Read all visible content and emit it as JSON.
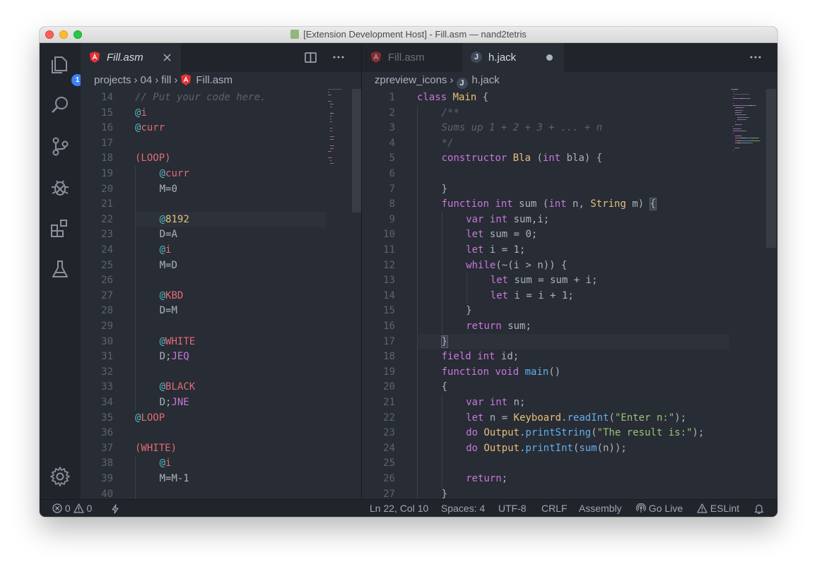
{
  "window": {
    "title": "[Extension Development Host] - Fill.asm — nand2tetris"
  },
  "activity_bar": {
    "items": [
      {
        "name": "explorer-icon",
        "badge": "1"
      },
      {
        "name": "search-icon"
      },
      {
        "name": "source-control-icon"
      },
      {
        "name": "debug-icon"
      },
      {
        "name": "extensions-icon"
      },
      {
        "name": "testing-icon"
      }
    ],
    "manage": "gear-icon"
  },
  "left_editor": {
    "tab": {
      "label": "Fill.asm"
    },
    "breadcrumb": [
      "projects",
      "04",
      "fill",
      "Fill.asm"
    ],
    "lines": [
      {
        "n": "14",
        "tokens": [
          [
            "c",
            "// Put your code here."
          ]
        ],
        "indent": 0
      },
      {
        "n": "15",
        "tokens": [
          [
            "a",
            "@"
          ],
          [
            "r",
            "i"
          ]
        ],
        "indent": 0
      },
      {
        "n": "16",
        "tokens": [
          [
            "a",
            "@"
          ],
          [
            "r",
            "curr"
          ]
        ],
        "indent": 0
      },
      {
        "n": "17",
        "tokens": [],
        "indent": 0
      },
      {
        "n": "18",
        "tokens": [
          [
            "r",
            "(LOOP)"
          ]
        ],
        "indent": 0
      },
      {
        "n": "19",
        "tokens": [
          [
            "a",
            "@"
          ],
          [
            "r",
            "curr"
          ]
        ],
        "indent": 1
      },
      {
        "n": "20",
        "tokens": [
          [
            "p",
            "M=0"
          ]
        ],
        "indent": 1
      },
      {
        "n": "21",
        "tokens": [],
        "indent": 1
      },
      {
        "n": "22",
        "tokens": [
          [
            "a",
            "@"
          ],
          [
            "y",
            "8192"
          ]
        ],
        "indent": 1
      },
      {
        "n": "23",
        "tokens": [
          [
            "p",
            "D=A"
          ]
        ],
        "indent": 1
      },
      {
        "n": "24",
        "tokens": [
          [
            "a",
            "@"
          ],
          [
            "r",
            "i"
          ]
        ],
        "indent": 1
      },
      {
        "n": "25",
        "tokens": [
          [
            "p",
            "M=D"
          ]
        ],
        "indent": 1
      },
      {
        "n": "26",
        "tokens": [],
        "indent": 1
      },
      {
        "n": "27",
        "tokens": [
          [
            "a",
            "@"
          ],
          [
            "r",
            "KBD"
          ]
        ],
        "indent": 1
      },
      {
        "n": "28",
        "tokens": [
          [
            "p",
            "D=M"
          ]
        ],
        "indent": 1
      },
      {
        "n": "29",
        "tokens": [],
        "indent": 1
      },
      {
        "n": "30",
        "tokens": [
          [
            "a",
            "@"
          ],
          [
            "r",
            "WHITE"
          ]
        ],
        "indent": 1
      },
      {
        "n": "31",
        "tokens": [
          [
            "p",
            "D;"
          ],
          [
            "k",
            "JEQ"
          ]
        ],
        "indent": 1
      },
      {
        "n": "32",
        "tokens": [],
        "indent": 1
      },
      {
        "n": "33",
        "tokens": [
          [
            "a",
            "@"
          ],
          [
            "r",
            "BLACK"
          ]
        ],
        "indent": 1
      },
      {
        "n": "34",
        "tokens": [
          [
            "p",
            "D;"
          ],
          [
            "k",
            "JNE"
          ]
        ],
        "indent": 1
      },
      {
        "n": "35",
        "tokens": [
          [
            "a",
            "@"
          ],
          [
            "r",
            "LOOP"
          ]
        ],
        "indent": 0
      },
      {
        "n": "36",
        "tokens": [],
        "indent": 0
      },
      {
        "n": "37",
        "tokens": [
          [
            "r",
            "(WHITE)"
          ]
        ],
        "indent": 0
      },
      {
        "n": "38",
        "tokens": [
          [
            "a",
            "@"
          ],
          [
            "r",
            "i"
          ]
        ],
        "indent": 1
      },
      {
        "n": "39",
        "tokens": [
          [
            "p",
            "M=M-1"
          ]
        ],
        "indent": 1
      },
      {
        "n": "40",
        "tokens": [],
        "indent": 1
      }
    ]
  },
  "right_editor": {
    "tabs": [
      {
        "label": "Fill.asm",
        "icon": "angular-icon",
        "active": false
      },
      {
        "label": "h.jack",
        "icon": "jack-icon",
        "active": true,
        "dirty": true
      }
    ],
    "breadcrumb": [
      "zpreview_icons",
      "h.jack"
    ],
    "lines": [
      {
        "n": "1",
        "indent": 0,
        "tokens": [
          [
            "k",
            "class "
          ],
          [
            "t",
            "Main"
          ],
          [
            "p",
            " {"
          ]
        ]
      },
      {
        "n": "2",
        "indent": 1,
        "tokens": [
          [
            "c",
            "/**"
          ]
        ]
      },
      {
        "n": "3",
        "indent": 1,
        "tokens": [
          [
            "c",
            "Sums up 1 + 2 + 3 + ... + n"
          ]
        ]
      },
      {
        "n": "4",
        "indent": 1,
        "tokens": [
          [
            "c",
            "*/"
          ]
        ]
      },
      {
        "n": "5",
        "indent": 1,
        "tokens": [
          [
            "k",
            "constructor "
          ],
          [
            "t",
            "Bla"
          ],
          [
            "p",
            " ("
          ],
          [
            "k",
            "int"
          ],
          [
            "p",
            " bla) {"
          ]
        ]
      },
      {
        "n": "6",
        "indent": 1,
        "tokens": []
      },
      {
        "n": "7",
        "indent": 1,
        "tokens": [
          [
            "p",
            "}"
          ]
        ]
      },
      {
        "n": "8",
        "indent": 1,
        "tokens": [
          [
            "k",
            "function "
          ],
          [
            "k",
            "int"
          ],
          [
            "p",
            " sum ("
          ],
          [
            "k",
            "int"
          ],
          [
            "p",
            " n, "
          ],
          [
            "t",
            "String"
          ],
          [
            "p",
            " m) "
          ],
          [
            "bh",
            "{"
          ]
        ]
      },
      {
        "n": "9",
        "indent": 2,
        "tokens": [
          [
            "k",
            "var "
          ],
          [
            "k",
            "int"
          ],
          [
            "p",
            " sum,i;"
          ]
        ]
      },
      {
        "n": "10",
        "indent": 2,
        "tokens": [
          [
            "k",
            "let"
          ],
          [
            "p",
            " sum = 0;"
          ]
        ]
      },
      {
        "n": "11",
        "indent": 2,
        "tokens": [
          [
            "k",
            "let"
          ],
          [
            "p",
            " i = 1;"
          ]
        ]
      },
      {
        "n": "12",
        "indent": 2,
        "tokens": [
          [
            "k",
            "while"
          ],
          [
            "p",
            "(~(i > n)) {"
          ]
        ]
      },
      {
        "n": "13",
        "indent": 3,
        "tokens": [
          [
            "k",
            "let"
          ],
          [
            "p",
            " sum = sum + i;"
          ]
        ]
      },
      {
        "n": "14",
        "indent": 3,
        "tokens": [
          [
            "k",
            "let"
          ],
          [
            "p",
            " i = i + 1;"
          ]
        ]
      },
      {
        "n": "15",
        "indent": 2,
        "tokens": [
          [
            "p",
            "}"
          ]
        ]
      },
      {
        "n": "16",
        "indent": 2,
        "tokens": [
          [
            "k",
            "return"
          ],
          [
            "p",
            " sum;"
          ]
        ]
      },
      {
        "n": "17",
        "indent": 1,
        "tokens": [
          [
            "bh",
            "}"
          ]
        ]
      },
      {
        "n": "18",
        "indent": 1,
        "tokens": [
          [
            "k",
            "field "
          ],
          [
            "k",
            "int"
          ],
          [
            "p",
            " id;"
          ]
        ]
      },
      {
        "n": "19",
        "indent": 1,
        "tokens": [
          [
            "k",
            "function "
          ],
          [
            "k",
            "void"
          ],
          [
            "p",
            " "
          ],
          [
            "f",
            "main"
          ],
          [
            "p",
            "()"
          ]
        ]
      },
      {
        "n": "20",
        "indent": 1,
        "tokens": [
          [
            "p",
            "{"
          ]
        ]
      },
      {
        "n": "21",
        "indent": 2,
        "tokens": [
          [
            "k",
            "var "
          ],
          [
            "k",
            "int"
          ],
          [
            "p",
            " n;"
          ]
        ]
      },
      {
        "n": "22",
        "indent": 2,
        "tokens": [
          [
            "k",
            "let"
          ],
          [
            "p",
            " n = "
          ],
          [
            "t",
            "Keyboard"
          ],
          [
            "p",
            "."
          ],
          [
            "f",
            "readInt"
          ],
          [
            "p",
            "("
          ],
          [
            "s",
            "\"Enter n:\""
          ],
          [
            "p",
            ");"
          ]
        ]
      },
      {
        "n": "23",
        "indent": 2,
        "tokens": [
          [
            "k",
            "do "
          ],
          [
            "t",
            "Output"
          ],
          [
            "p",
            "."
          ],
          [
            "f",
            "printString"
          ],
          [
            "p",
            "("
          ],
          [
            "s",
            "\"The result is:\""
          ],
          [
            "p",
            ");"
          ]
        ]
      },
      {
        "n": "24",
        "indent": 2,
        "tokens": [
          [
            "k",
            "do "
          ],
          [
            "t",
            "Output"
          ],
          [
            "p",
            "."
          ],
          [
            "f",
            "printInt"
          ],
          [
            "p",
            "("
          ],
          [
            "f",
            "sum"
          ],
          [
            "p",
            "(n));"
          ]
        ]
      },
      {
        "n": "25",
        "indent": 2,
        "tokens": []
      },
      {
        "n": "26",
        "indent": 2,
        "tokens": [
          [
            "k",
            "return"
          ],
          [
            "p",
            ";"
          ]
        ]
      },
      {
        "n": "27",
        "indent": 1,
        "tokens": [
          [
            "p",
            "}"
          ]
        ]
      }
    ]
  },
  "status_bar": {
    "errors": "0",
    "warnings": "0",
    "position": "Ln 22, Col 10",
    "spaces": "Spaces: 4",
    "encoding": "UTF-8",
    "eol": "CRLF",
    "language": "Assembly",
    "golive": "Go Live",
    "eslint": "ESLint"
  },
  "colors": {
    "accent": "#3b82f6",
    "angular": "#e23237",
    "editor_bg": "#282c34"
  }
}
